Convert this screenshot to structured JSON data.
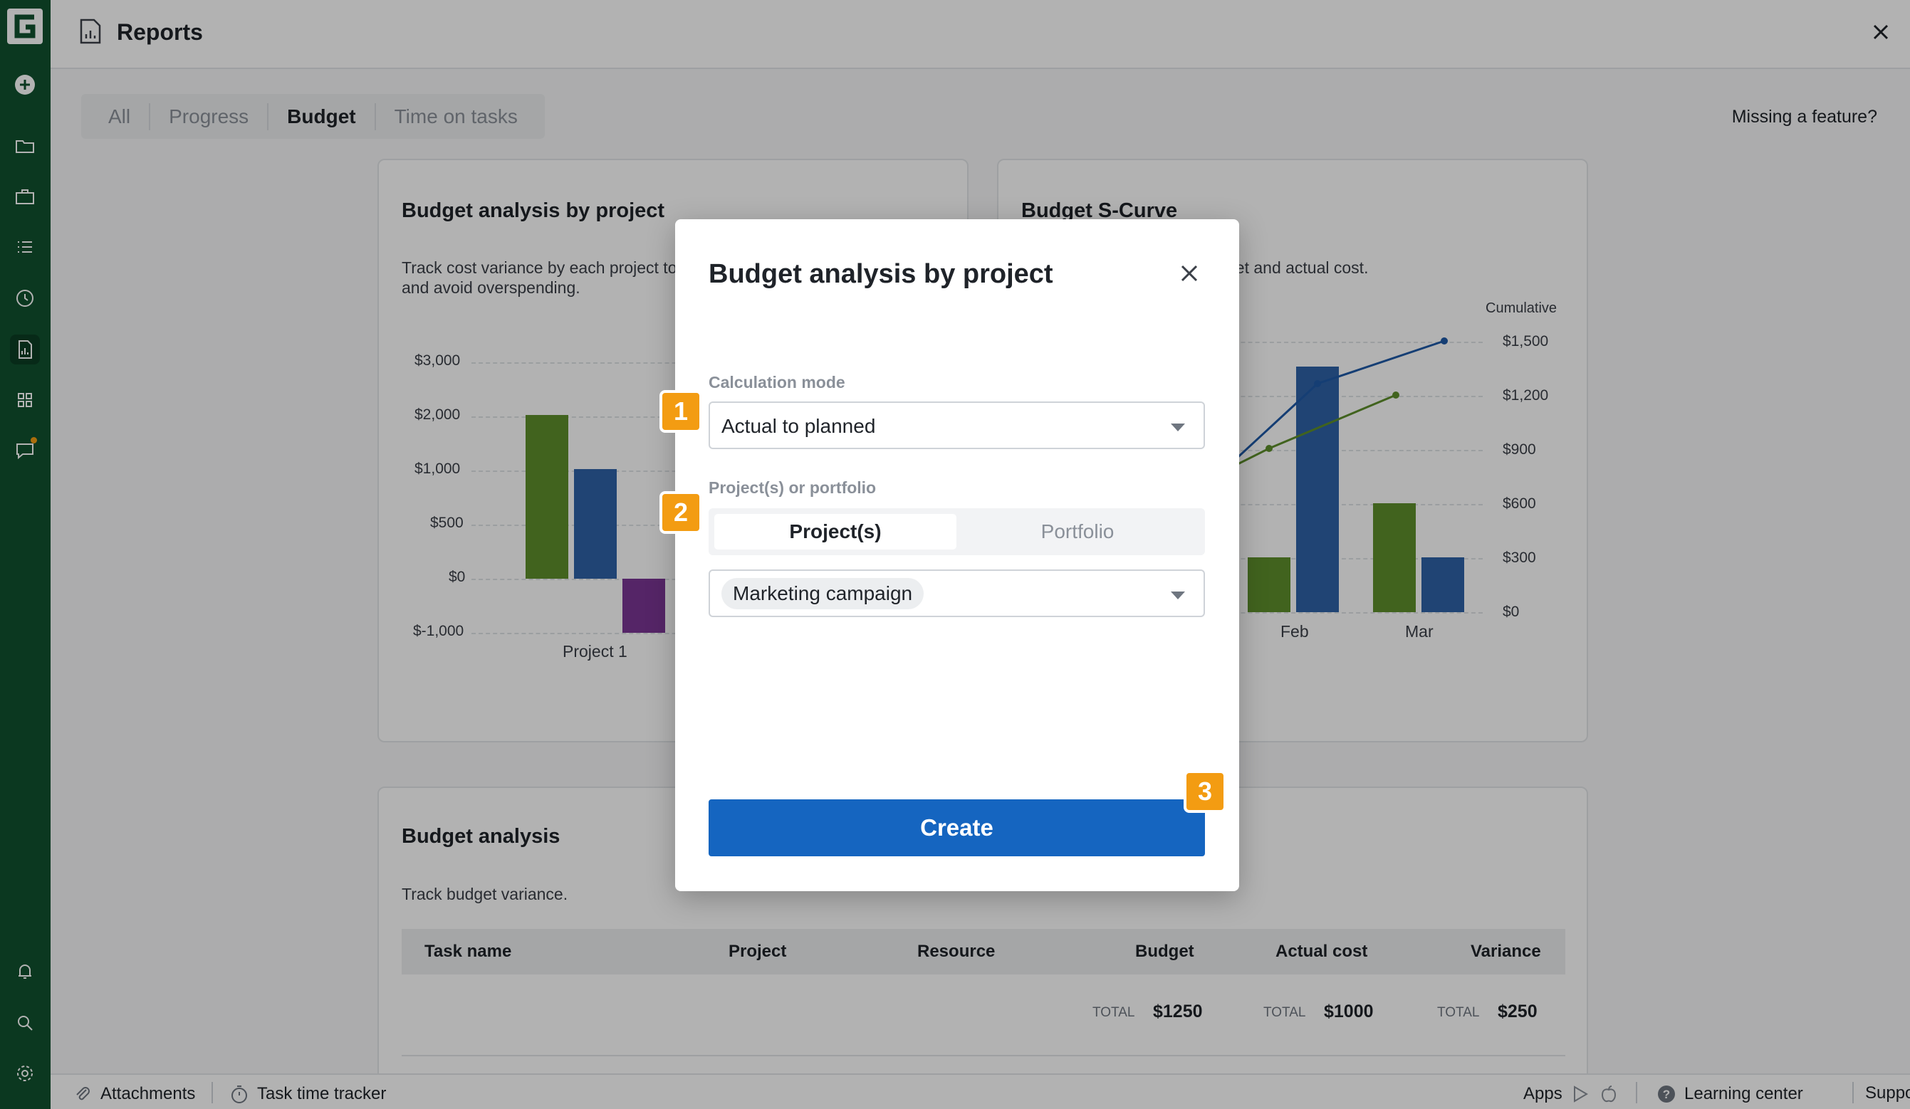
{
  "header": {
    "title": "Reports"
  },
  "tabs": [
    {
      "label": "All",
      "active": false
    },
    {
      "label": "Progress",
      "active": false
    },
    {
      "label": "Budget",
      "active": true
    },
    {
      "label": "Time on tasks",
      "active": false
    }
  ],
  "missing_feature": "Missing a feature?",
  "cards": {
    "budget_by_project": {
      "title": "Budget analysis by project",
      "description_line1": "Track cost variance by each project to",
      "description_line2": "and avoid overspending.",
      "y_ticks": [
        "$3,000",
        "$2,000",
        "$1,000",
        "$500",
        "$0",
        "$-1,000"
      ],
      "x_label": "Project 1"
    },
    "s_curve": {
      "title": "Budget S-Curve",
      "description": "get and actual cost.",
      "right_axis_title": "Cumulative",
      "y_ticks": [
        "$1,500",
        "$1,200",
        "$900",
        "$600",
        "$300",
        "$0"
      ],
      "x_labels": [
        "Feb",
        "Mar"
      ]
    },
    "budget_analysis": {
      "title": "Budget analysis",
      "description": "Track budget variance.",
      "columns": [
        "Task name",
        "Project",
        "Resource",
        "Budget",
        "Actual cost",
        "Variance"
      ],
      "totals": [
        {
          "label": "TOTAL",
          "value": "$1250"
        },
        {
          "label": "TOTAL",
          "value": "$1000"
        },
        {
          "label": "TOTAL",
          "value": "$250"
        }
      ]
    }
  },
  "colors": {
    "green": "#5d8f2b",
    "blue": "#2f62a6",
    "purple": "#7a3594",
    "accent": "#1565c0",
    "badge": "#f39c12",
    "rail": "#10512f"
  },
  "modal": {
    "title": "Budget analysis by project",
    "calc_label": "Calculation mode",
    "calc_value": "Actual to planned",
    "scope_label": "Project(s) or portfolio",
    "segment_projects": "Project(s)",
    "segment_portfolio": "Portfolio",
    "project_chip": "Marketing campaign",
    "create_label": "Create",
    "badges": [
      "1",
      "2",
      "3"
    ]
  },
  "footer": {
    "attachments": "Attachments",
    "time_tracker": "Task time tracker",
    "apps": "Apps",
    "learning": "Learning center",
    "support": "Support"
  }
}
